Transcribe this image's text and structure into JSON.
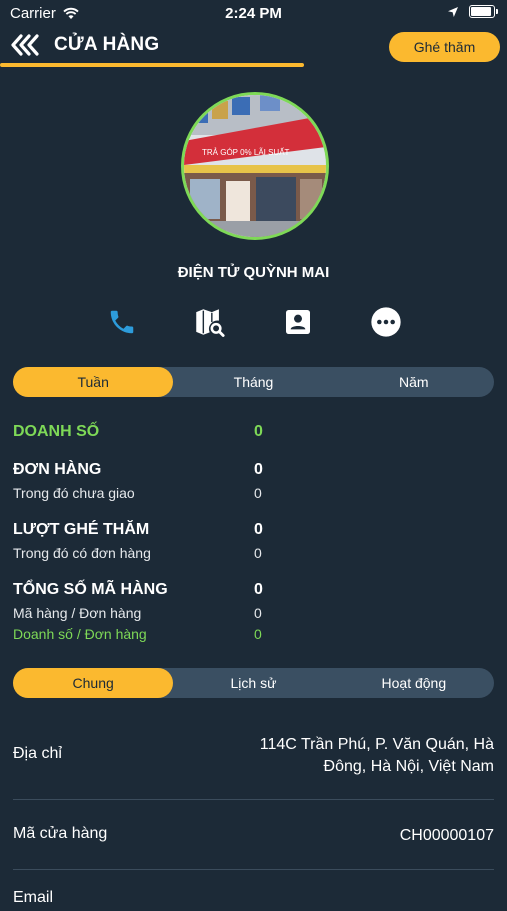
{
  "status_bar": {
    "carrier": "Carrier",
    "time": "2:24 PM"
  },
  "header": {
    "title": "CỬA HÀNG",
    "visit_button": "Ghé thăm"
  },
  "store": {
    "name": "ĐIỆN TỬ QUỲNH MAI",
    "photo_sign_text": "TRẢ GÓP 0% LÃI SUẤT"
  },
  "actions": [
    "phone-icon",
    "map-search-icon",
    "contact-card-icon",
    "more-icon"
  ],
  "period_tabs": {
    "items": [
      "Tuần",
      "Tháng",
      "Năm"
    ],
    "active": "Tuần"
  },
  "stats": {
    "sales_label": "DOANH SỐ",
    "sales_value": "0",
    "orders_label": "ĐƠN HÀNG",
    "orders_value": "0",
    "undelivered_label": "Trong đó chưa giao",
    "undelivered_value": "0",
    "visits_label": "LƯỢT GHÉ THĂM",
    "visits_value": "0",
    "visits_with_orders_label": "Trong đó có đơn hàng",
    "visits_with_orders_value": "0",
    "sku_total_label": "TỔNG SỐ MÃ HÀNG",
    "sku_total_value": "0",
    "sku_per_order_label": "Mã hàng / Đơn hàng",
    "sku_per_order_value": "0",
    "sales_per_order_label": "Doanh số / Đơn hàng",
    "sales_per_order_value": "0"
  },
  "info_tabs": {
    "items": [
      "Chung",
      "Lịch sử",
      "Hoạt động"
    ],
    "active": "Chung"
  },
  "info": {
    "address_label": "Địa chỉ",
    "address_line1": "114C Trần Phú, P. Văn Quán, Hà",
    "address_line2": "Đông, Hà Nội, Việt Nam",
    "store_code_label": "Mã cửa hàng",
    "store_code_value": "CH00000107",
    "email_label": "Email"
  },
  "colors": {
    "background": "#1c2a37",
    "accent": "#fbb92f",
    "green": "#7ed957",
    "phone_blue": "#2d9cdb"
  }
}
